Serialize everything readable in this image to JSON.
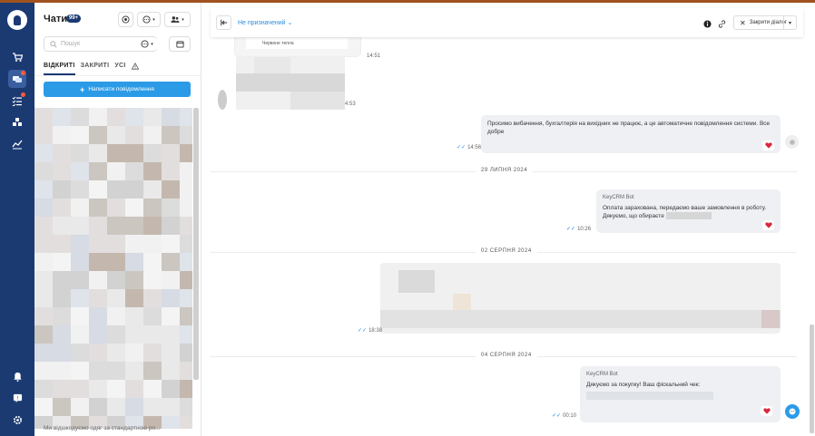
{
  "app": {
    "brand_color": "#1b3a72",
    "accent_color": "#2b9be8"
  },
  "rail": {
    "items": [
      {
        "icon": "cart-icon"
      },
      {
        "icon": "chat-icon",
        "active": true,
        "has_dot": true
      },
      {
        "icon": "tasks-icon",
        "has_dot": true
      },
      {
        "icon": "warehouse-icon"
      },
      {
        "icon": "analytics-icon"
      }
    ],
    "bottom_items": [
      {
        "icon": "bell-icon"
      },
      {
        "icon": "help-icon"
      },
      {
        "icon": "settings-icon"
      }
    ]
  },
  "chats": {
    "title": "Чати",
    "badge": "99+",
    "search_placeholder": "Пошук",
    "tabs": [
      {
        "label": "ВІДКРИТІ",
        "active": true
      },
      {
        "label": "ЗАКРИТІ"
      },
      {
        "label": "УСІ"
      }
    ],
    "new_message_label": "Написати повідомлення",
    "last_preview": "Ми відшкодуємо одяг за стандартною ро..."
  },
  "conversation": {
    "assignee": "Не призначений",
    "close_label": "Закрити діалог",
    "partial_caption": "Червоне тепла",
    "messages": [
      {
        "time": "14:51"
      },
      {
        "time": "4:53"
      },
      {
        "text": "Просимо вибачення, бухгалтерія на вихідних не працює, а це автоматичне повідомлення системи. Все добре",
        "time": "14:56"
      },
      {
        "sender": "KeyCRM Bot",
        "text_line1": "Оплата зарахована, передаємо ваше замовлення в роботу.",
        "text_line2": "Дякуємо, що обираєте",
        "time": "10:26"
      },
      {
        "time": "18:38"
      },
      {
        "sender": "KeyCRM Bot",
        "text": "Дякуємо за покупку! Ваш фіскальний чек:",
        "time": "00:10"
      }
    ],
    "days": [
      {
        "label": "29 ЛИПНЯ 2024"
      },
      {
        "label": "02 СЕРПНЯ 2024"
      },
      {
        "label": "04 СЕРПНЯ 2024"
      }
    ]
  }
}
